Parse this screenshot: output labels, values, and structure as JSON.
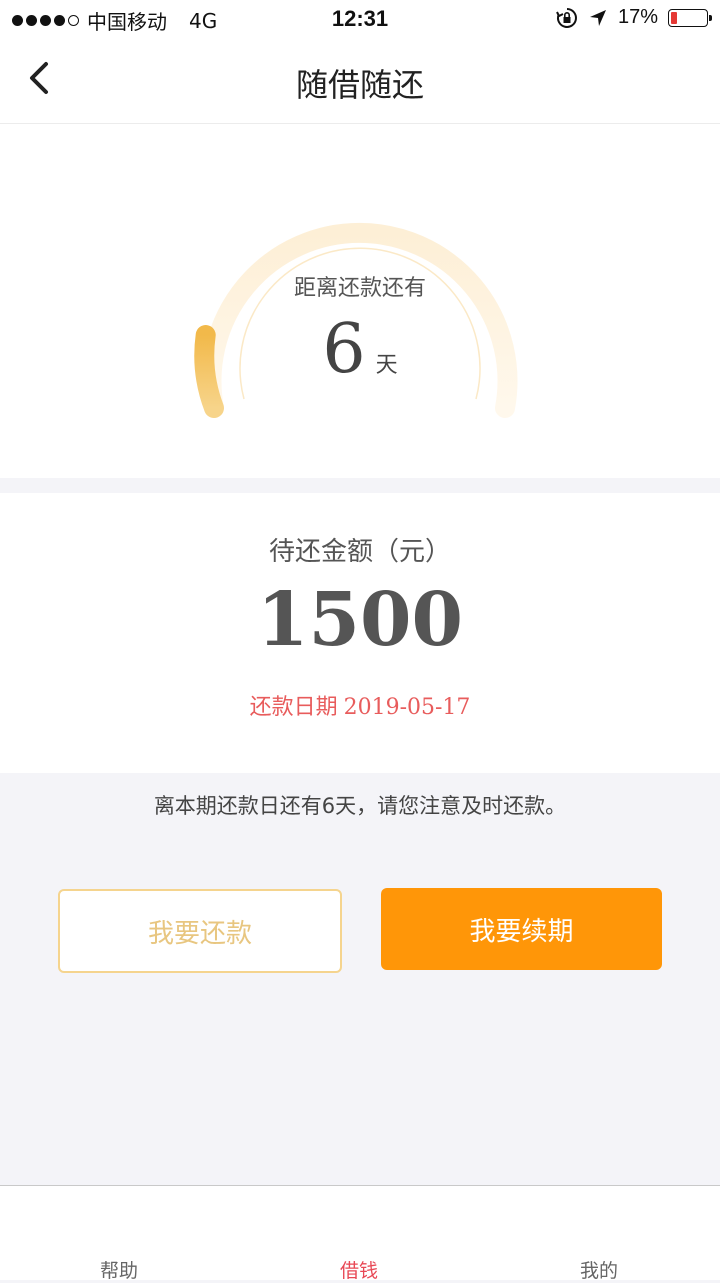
{
  "status_bar": {
    "carrier": "中国移动",
    "network": "4G",
    "time": "12:31",
    "battery": "17%",
    "battery_level": 0.17
  },
  "nav": {
    "title": "随借随还",
    "back_icon": "chevron-left-icon"
  },
  "gauge": {
    "label": "距离还款还有",
    "value": "6",
    "unit": "天",
    "colors": {
      "track": "#fdf0d9",
      "fill": "#f5c150"
    }
  },
  "amount": {
    "label": "待还金额（元）",
    "value": "1500",
    "due_label": "还款日期",
    "due_date": "2019-05-17"
  },
  "reminder": "离本期还款日还有6天，请您注意及时还款。",
  "buttons": {
    "repay": "我要还款",
    "renew": "我要续期"
  },
  "tabs": [
    {
      "label": "帮助"
    },
    {
      "label": "借钱",
      "active": true
    },
    {
      "label": "我的"
    }
  ],
  "colors": {
    "accent": "#ff9608",
    "tab_active": "#e84855",
    "due_date": "#e85c5c",
    "repay_border": "#f5d48e"
  }
}
